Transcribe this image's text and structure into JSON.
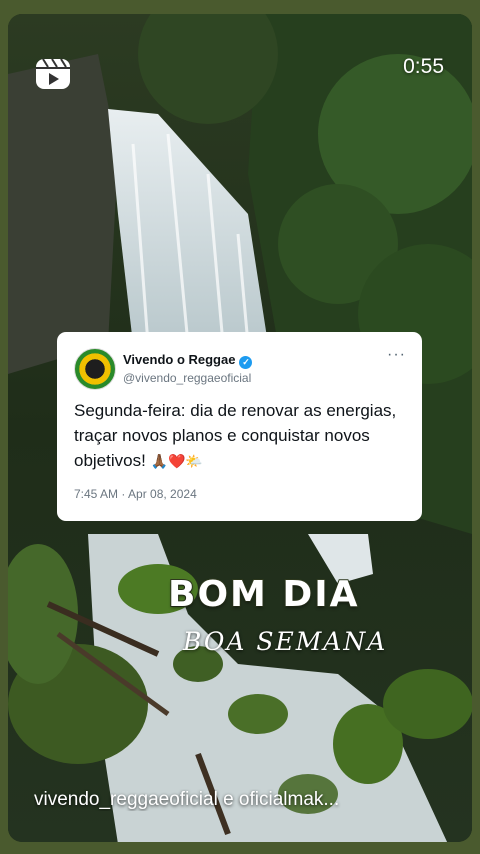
{
  "player": {
    "time_remaining": "0:55",
    "icons": [
      "reels-icon"
    ]
  },
  "tweet": {
    "display_name": "Vivendo o Reggae",
    "handle": "@vivendo_reggaeoficial",
    "verified": true,
    "text": "Segunda-feira: dia de renovar as energias, traçar novos planos e conquistar novos objetivos!",
    "emojis": "🙏🏾❤️🌤️",
    "timestamp": "7:45 AM · Apr 08, 2024",
    "more_label": "···"
  },
  "overlay": {
    "title": "BOM DIA",
    "subtitle": "BOA SEMANA"
  },
  "caption": "vivendo_reggaeoficial e oficialmak...",
  "colors": {
    "page_background": "#4a5a2e",
    "verified_badge": "#1d9bf0",
    "tweet_card": "#ffffff"
  }
}
